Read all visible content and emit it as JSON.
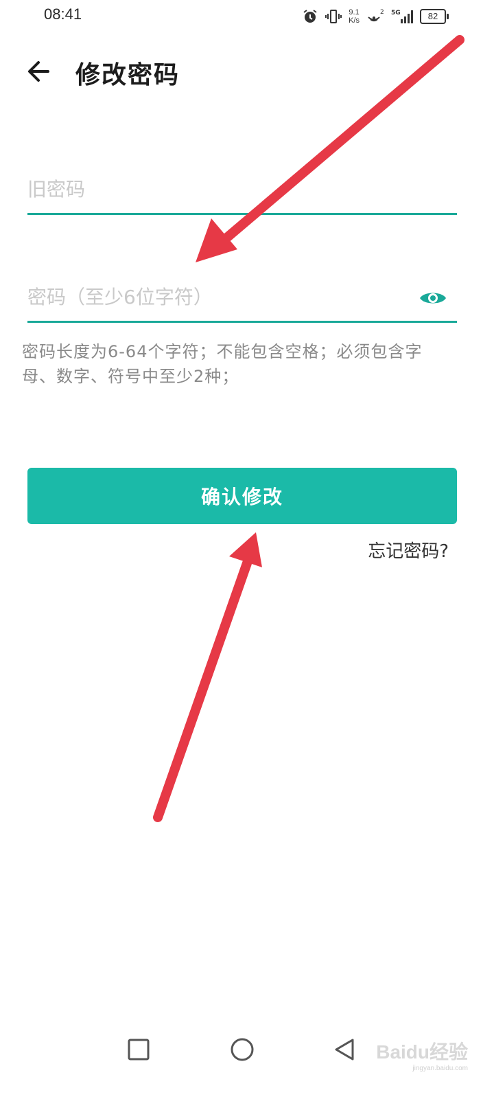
{
  "status_bar": {
    "time": "08:41",
    "speed_value": "9.1",
    "speed_unit": "K/s",
    "network": "5G",
    "sim": "2",
    "battery": "82"
  },
  "header": {
    "title": "修改密码"
  },
  "form": {
    "old_password": {
      "value": "",
      "placeholder": "旧密码"
    },
    "new_password": {
      "value": "",
      "placeholder": "密码（至少6位字符）"
    },
    "hint_line1": "密码长度为6-64个字符；不能包含空格；必须包含字",
    "hint_line2": "母、数字、符号中至少2种；",
    "submit_label": "确认修改",
    "forgot_label": "忘记密码?"
  },
  "watermark": {
    "brand": "Baidu经验",
    "url": "jingyan.baidu.com"
  },
  "colors": {
    "accent": "#1bbaa8",
    "underline": "#1aa999",
    "annotation_arrow": "#e63946"
  },
  "icons": [
    "back-arrow-icon",
    "eye-icon",
    "alarm-icon",
    "vibrate-icon",
    "hotspot-icon",
    "signal-icon",
    "battery-icon",
    "square-nav-icon",
    "circle-nav-icon",
    "triangle-nav-icon"
  ]
}
